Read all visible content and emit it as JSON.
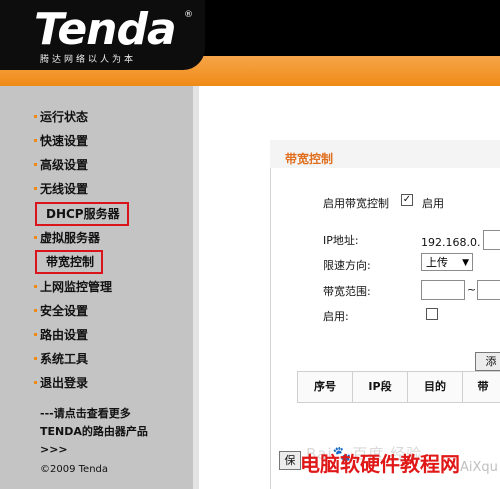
{
  "header": {
    "logo": "Tenda",
    "registered_mark": "®",
    "slogan": "腾达网络以人为本"
  },
  "sidebar": {
    "items": [
      {
        "label": "运行状态"
      },
      {
        "label": "快速设置"
      },
      {
        "label": "高级设置"
      },
      {
        "label": "无线设置"
      },
      {
        "label": "DHCP服务器"
      },
      {
        "label": "虚拟服务器"
      },
      {
        "label": "带宽控制"
      },
      {
        "label": "上网监控管理"
      },
      {
        "label": "安全设置"
      },
      {
        "label": "路由设置"
      },
      {
        "label": "系统工具"
      },
      {
        "label": "退出登录"
      }
    ],
    "more_line1": "---请点击查看更多",
    "more_line2": "TENDA的路由器产品",
    "more_line3": ">>>",
    "copyright": "©2009 Tenda"
  },
  "panel": {
    "title": "带宽控制",
    "enable_label": "启用带宽控制",
    "enable_checked_text": "✓",
    "enable_text": "启用",
    "ip_label": "IP地址:",
    "ip_prefix": "192.168.0.",
    "direction_label": "限速方向:",
    "direction_value": "上传",
    "range_label": "带宽范围:",
    "range_tilde": "~",
    "enabled_label": "启用:",
    "add_button": "添",
    "save_button": "保",
    "table_headers": [
      "序号",
      "IP段",
      "目的",
      "带"
    ]
  },
  "overlay": {
    "watermark": "Bai🐾百度 经验",
    "bottom_text": "电脑软硬件教程网",
    "bottom_domain": "AiXqu"
  },
  "colors": {
    "accent_orange": "#f08a16",
    "highlight_red": "#d9141b"
  }
}
